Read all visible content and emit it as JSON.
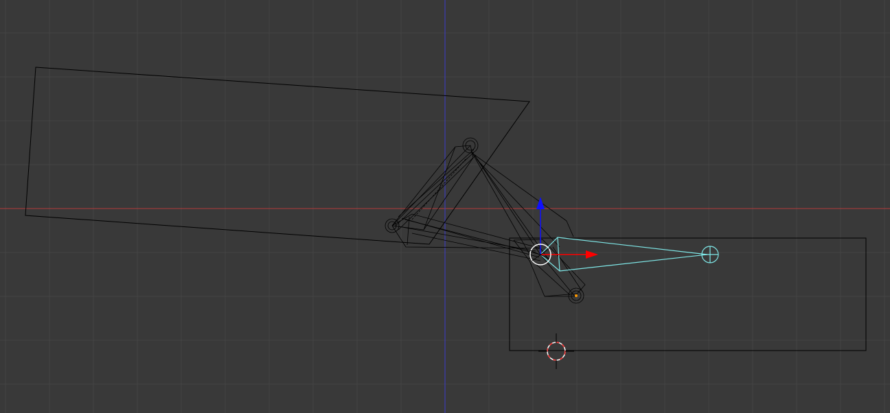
{
  "viewport": {
    "view": "front-orthographic",
    "background_color": "#393939",
    "grid_color": "#444444",
    "x_axis_color": "#b33b3b",
    "z_axis_color": "#3b3bcc",
    "wire_color": "#000000",
    "active_bone_color": "#7fe8e8",
    "gizmo_x_color": "#ff0000",
    "gizmo_z_color": "#1010ff",
    "cursor_color": "#ff4444",
    "origin_color": "#ff9900"
  },
  "objects": {
    "planes": [
      "upper-plane",
      "lower-plane"
    ],
    "armature": {
      "bones": [
        "bone-upper-arm",
        "bone-forearm",
        "bone-lower-link"
      ],
      "selected_bone": "bone-active"
    }
  },
  "widgets": {
    "transform_gizmo": [
      "gizmo-x-arrow-icon",
      "gizmo-z-arrow-icon",
      "gizmo-center-icon"
    ],
    "cursor": "3d-cursor-icon"
  }
}
